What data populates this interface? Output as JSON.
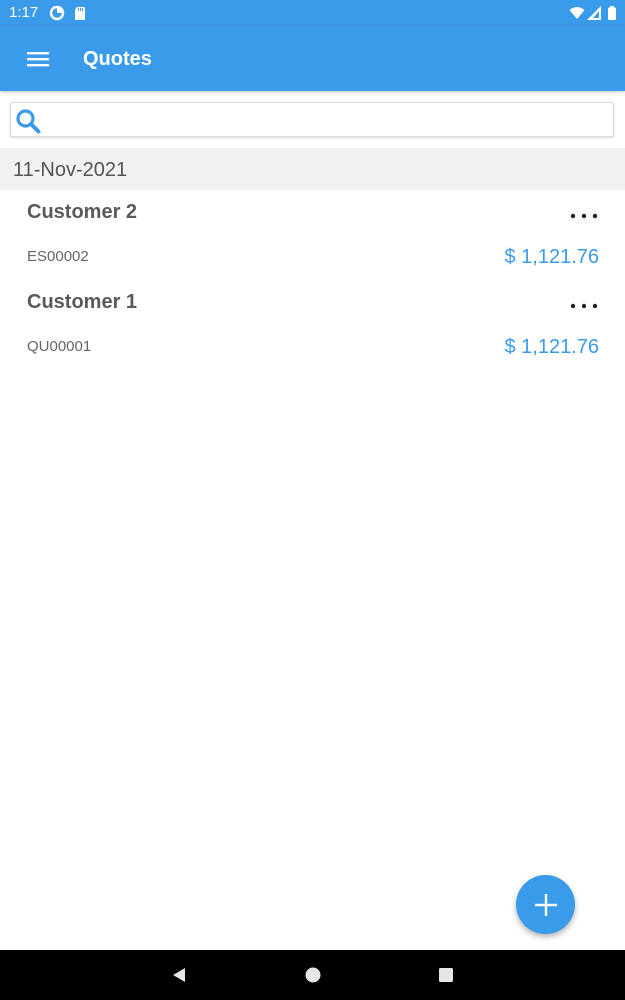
{
  "status_bar": {
    "time": "1:17",
    "icons": [
      "data-saver-icon",
      "sd-card-icon",
      "wifi-icon",
      "cell-signal-icon",
      "battery-icon"
    ]
  },
  "app_bar": {
    "title": "Quotes",
    "menu_icon": "hamburger-menu-icon",
    "background": "#3a9bea"
  },
  "search": {
    "placeholder": "",
    "value": "",
    "icon": "search-icon"
  },
  "groups": [
    {
      "date": "11-Nov-2021",
      "items": [
        {
          "customer": "Customer 2",
          "number": "ES00002",
          "amount": "$ 1,121.76"
        },
        {
          "customer": "Customer 1",
          "number": "QU00001",
          "amount": "$ 1,121.76"
        }
      ]
    }
  ],
  "colors": {
    "accent": "#3a9bea",
    "date_header_bg": "#f2f1f4",
    "customer_text": "#5a5a5a"
  },
  "fab": {
    "icon": "plus-icon"
  },
  "nav_bar": {
    "icons": [
      "back-icon",
      "home-icon",
      "recents-icon"
    ]
  }
}
